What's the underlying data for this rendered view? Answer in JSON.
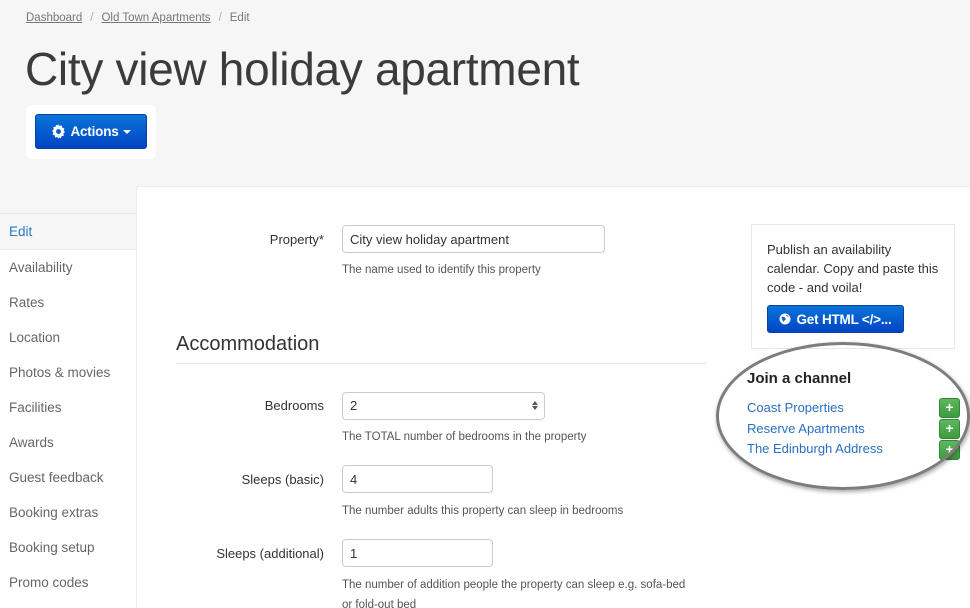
{
  "breadcrumb": {
    "items": [
      "Dashboard",
      "Old Town Apartments"
    ],
    "current": "Edit",
    "separator": "/"
  },
  "header": {
    "title": "City view holiday apartment",
    "actions_label": "Actions",
    "actions_icon": "gear-icon"
  },
  "sidebar": {
    "items": [
      {
        "label": "Edit",
        "active": true
      },
      {
        "label": "Availability"
      },
      {
        "label": "Rates"
      },
      {
        "label": "Location"
      },
      {
        "label": "Photos & movies"
      },
      {
        "label": "Facilities"
      },
      {
        "label": "Awards"
      },
      {
        "label": "Guest feedback"
      },
      {
        "label": "Booking extras"
      },
      {
        "label": "Booking setup"
      },
      {
        "label": "Promo codes"
      }
    ]
  },
  "form": {
    "property": {
      "label": "Property*",
      "value": "City view holiday apartment",
      "help": "The name used to identify this property"
    },
    "section_heading": "Accommodation",
    "bedrooms": {
      "label": "Bedrooms",
      "value": "2",
      "help": "The TOTAL number of bedrooms in the property"
    },
    "sleeps_basic": {
      "label": "Sleeps (basic)",
      "value": "4",
      "help": "The number adults this property can sleep in bedrooms"
    },
    "sleeps_additional": {
      "label": "Sleeps (additional)",
      "value": "1",
      "help_line1": "The number of addition people the property can sleep e.g. sofa-bed",
      "help_line2": "or fold-out bed"
    }
  },
  "publish_box": {
    "text": "Publish an availability calendar. Copy and paste this code - and voila!",
    "button_label": "Get HTML </>...",
    "button_icon": "globe-icon"
  },
  "channels": {
    "title": "Join a channel",
    "items": [
      {
        "label": "Coast Properties",
        "action": "+"
      },
      {
        "label": "Reserve Apartments",
        "action": "+"
      },
      {
        "label": "The Edinburgh Address",
        "action": "+"
      }
    ]
  },
  "colors": {
    "primary_button": "#0a5fd0",
    "link": "#2a6fc4",
    "add_button": "#4cae4c",
    "active_nav": "#2a7ac6",
    "page_bg": "#f6f6f6"
  }
}
